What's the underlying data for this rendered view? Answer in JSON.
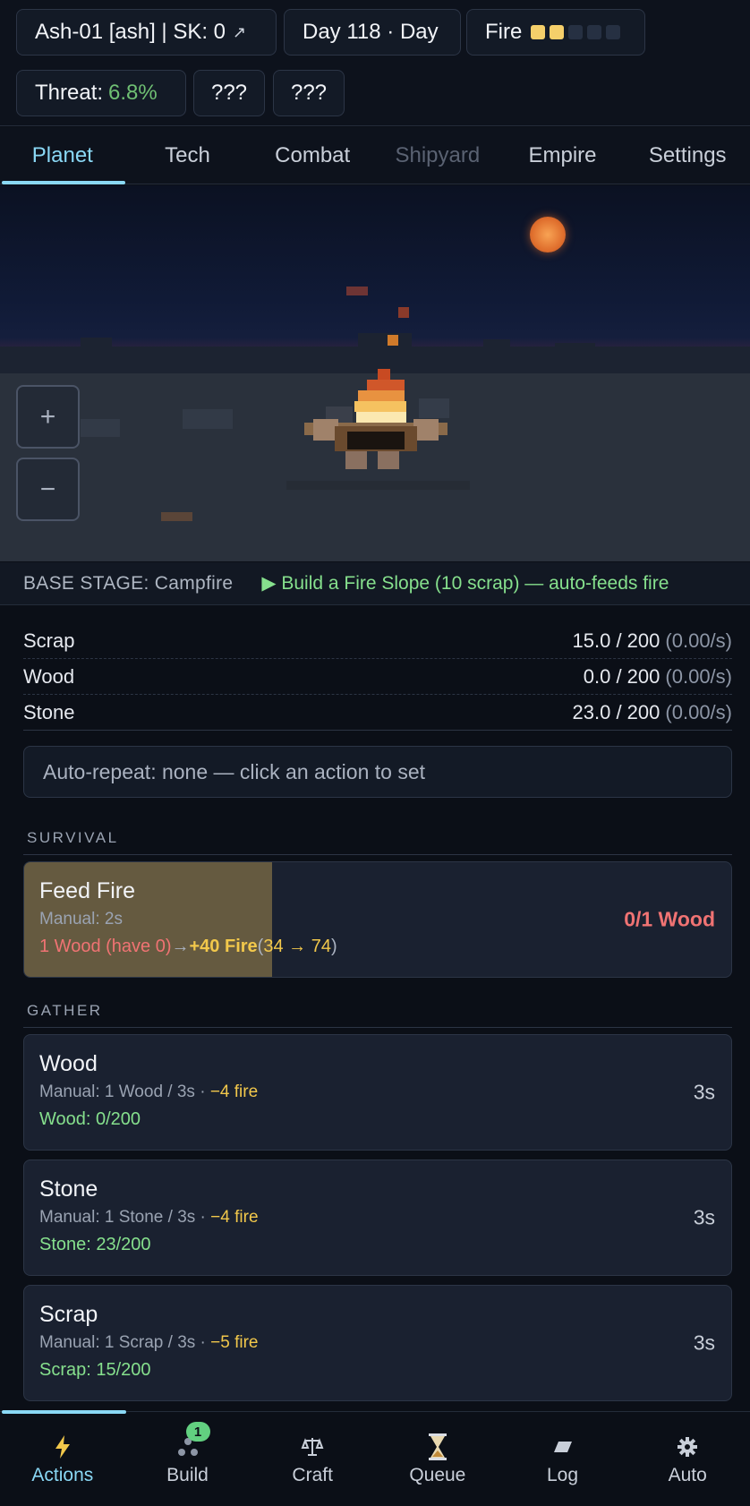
{
  "header": {
    "ship_chip": "Ash-01 [ash] | SK: 0",
    "ship_chip_arrow": "↗",
    "day_chip": "Day 118 · Day",
    "fire_label": "Fire",
    "fire_level": 2,
    "fire_max": 5,
    "threat_label": "Threat:",
    "threat_value": "6.8%",
    "unknown_1": "???",
    "unknown_2": "???"
  },
  "tabs": [
    "Planet",
    "Tech",
    "Combat",
    "Shipyard",
    "Empire",
    "Settings"
  ],
  "scene": {
    "zoom_in": "+",
    "zoom_out": "−"
  },
  "stage": {
    "label": "BASE STAGE: Campfire",
    "hint": "▶ Build a Fire Slope (10 scrap) — auto-feeds fire"
  },
  "resources": [
    {
      "name": "Scrap",
      "amount": "15.0 / 200",
      "rate": "(0.00/s)"
    },
    {
      "name": "Wood",
      "amount": "0.0 / 200",
      "rate": "(0.00/s)"
    },
    {
      "name": "Stone",
      "amount": "23.0 / 200",
      "rate": "(0.00/s)"
    }
  ],
  "autorepeat": "Auto-repeat: none — click an action to set",
  "sections": {
    "survival": "SURVIVAL",
    "gather": "GATHER"
  },
  "feed_fire": {
    "title": "Feed Fire",
    "manual": "Manual: 2s",
    "cost": "1 Wood (have 0)",
    "arrow": "→",
    "gain": "+40 Fire",
    "range": "(34 → 74)",
    "range_open": "(",
    "range_values": "34 → 74",
    "range_close": ")",
    "requirement": "0/1 Wood",
    "progress": 0.35
  },
  "gather": [
    {
      "title": "Wood",
      "manual": "Manual: 1 Wood / 3s · ",
      "fire": "−4 fire",
      "status": "Wood: 0/200",
      "time": "3s"
    },
    {
      "title": "Stone",
      "manual": "Manual: 1 Stone / 3s · ",
      "fire": "−4 fire",
      "status": "Stone: 23/200",
      "time": "3s"
    },
    {
      "title": "Scrap",
      "manual": "Manual: 1 Scrap / 3s · ",
      "fire": "−5 fire",
      "status": "Scrap: 15/200",
      "time": "3s"
    }
  ],
  "bottom_nav": [
    {
      "label": "Actions",
      "icon": "lightning-icon"
    },
    {
      "label": "Build",
      "icon": "dots-icon",
      "badge": "1"
    },
    {
      "label": "Craft",
      "icon": "scales-icon"
    },
    {
      "label": "Queue",
      "icon": "hourglass-icon"
    },
    {
      "label": "Log",
      "icon": "parallelogram-icon"
    },
    {
      "label": "Auto",
      "icon": "gear-icon"
    }
  ],
  "colors": {
    "accent": "#8ad8f5",
    "fire_pip": "#f5cf6a",
    "green": "#86e08d",
    "red": "#f07373",
    "yellow": "#f2c84b"
  }
}
